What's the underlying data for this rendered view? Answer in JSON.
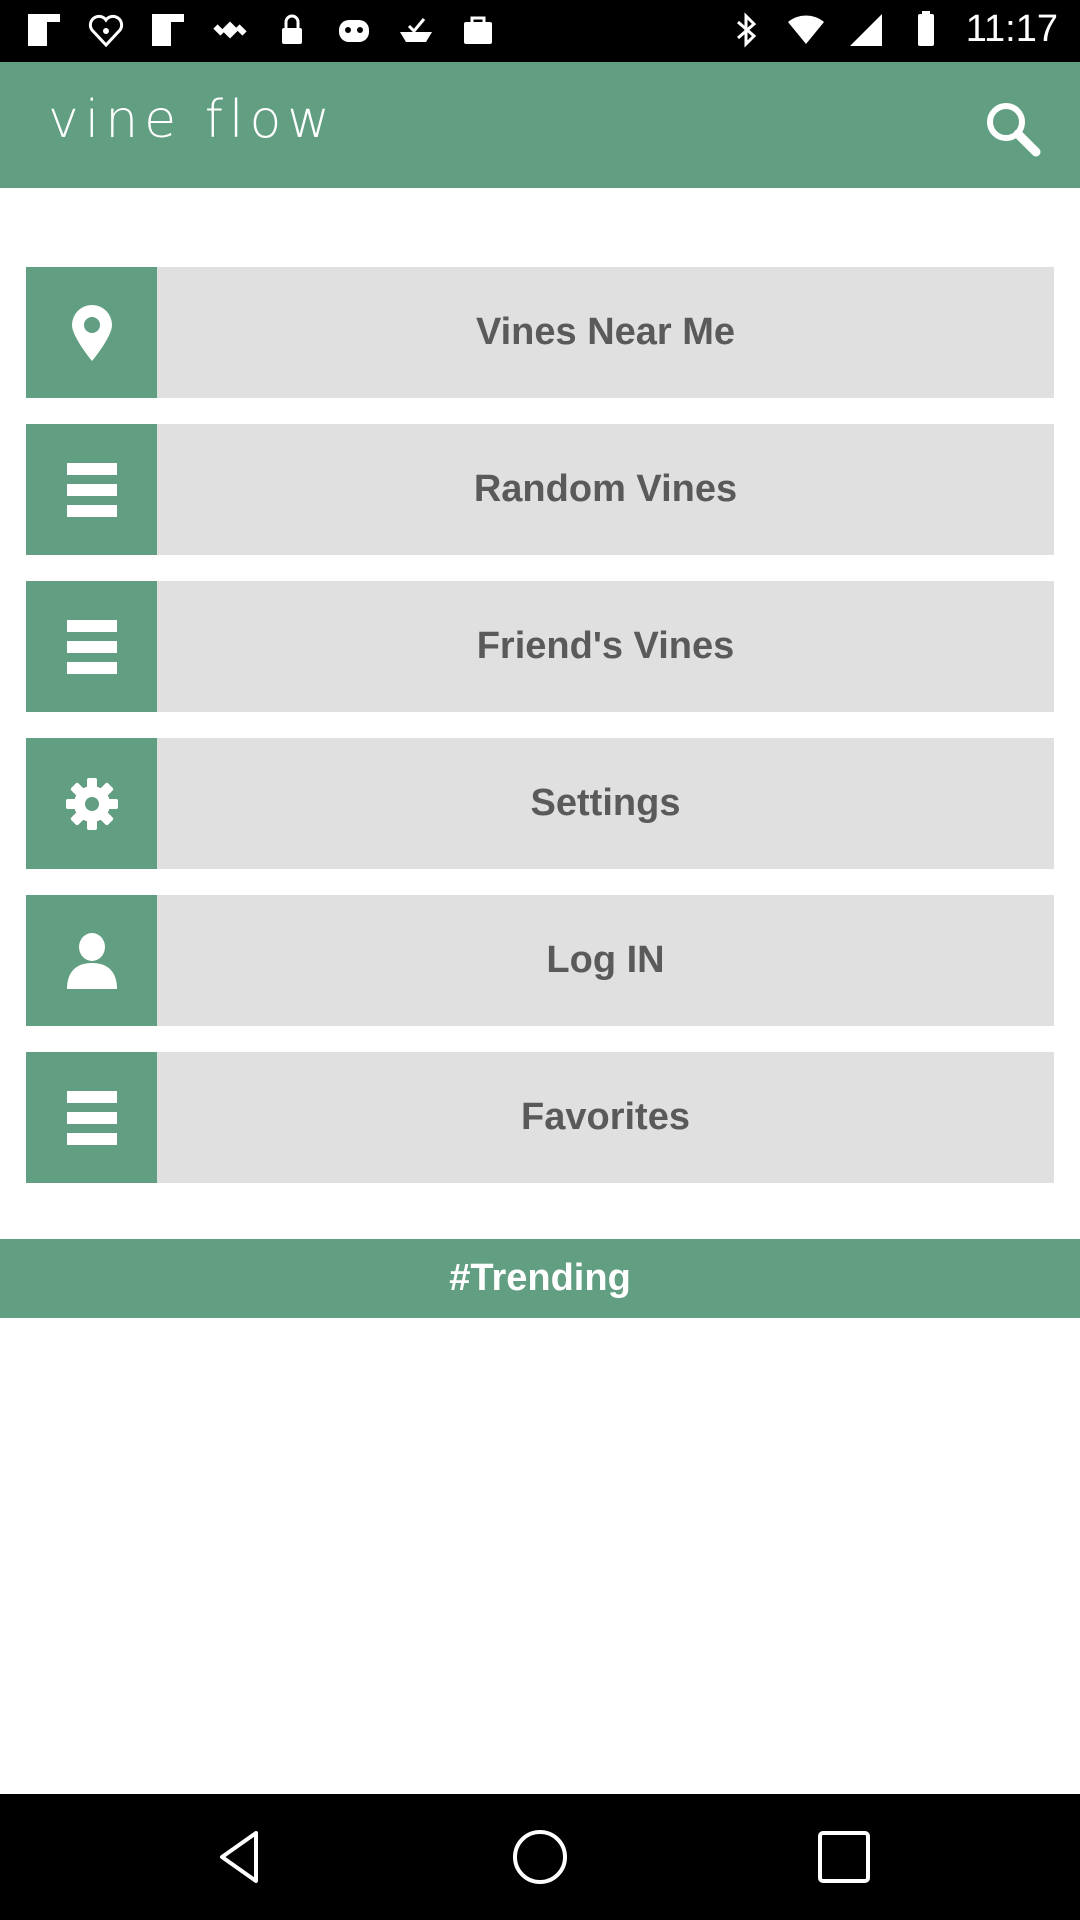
{
  "status_bar": {
    "time": "11:17",
    "left_icons": [
      "flipboard-icon",
      "iheartradio-icon",
      "flipboard-icon",
      "fake-gps-icon",
      "lock-icon",
      "game-icon",
      "check-tray-icon",
      "shopping-bag-icon"
    ],
    "right_icons": [
      "bluetooth-icon",
      "wifi-icon",
      "signal-icon",
      "battery-icon"
    ]
  },
  "header": {
    "title": "vine flow",
    "search_icon": "search-icon"
  },
  "menu": {
    "items": [
      {
        "label": "Vines Near Me",
        "icon": "location-pin-icon"
      },
      {
        "label": "Random Vines",
        "icon": "list-icon"
      },
      {
        "label": "Friend's Vines",
        "icon": "list-icon"
      },
      {
        "label": "Settings",
        "icon": "gear-icon"
      },
      {
        "label": "Log IN",
        "icon": "person-icon"
      },
      {
        "label": "Favorites",
        "icon": "list-icon"
      }
    ]
  },
  "trending": {
    "label": "#Trending"
  },
  "nav_bar": {
    "icons": [
      "back-icon",
      "home-icon",
      "recents-icon"
    ]
  },
  "colors": {
    "accent": "#629f82",
    "item_bg": "#e0e0e0",
    "item_text": "#5a5a5a"
  }
}
